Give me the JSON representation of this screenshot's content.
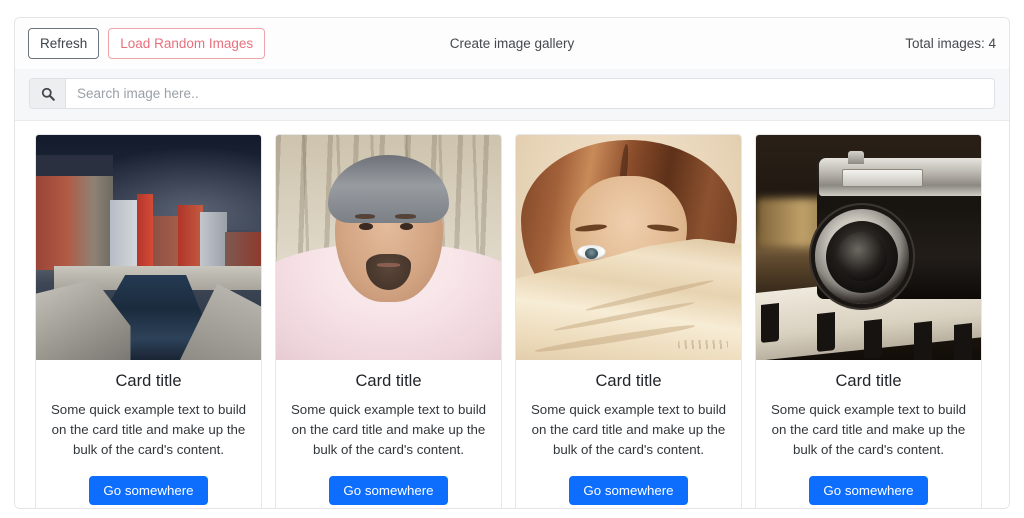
{
  "toolbar": {
    "refresh_label": "Refresh",
    "load_random_label": "Load Random Images",
    "title": "Create image gallery",
    "total_images_label": "Total images: 4"
  },
  "search": {
    "icon": "search-icon",
    "placeholder": "Search image here..",
    "value": ""
  },
  "colors": {
    "primary": "#0d6efd",
    "danger": "#e8707d",
    "secondary": "#6c757d",
    "panel_border": "#e3e5e8",
    "search_bg": "#f6f7f8"
  },
  "cards": [
    {
      "image_name": "riverside-city-photo",
      "image_alt": "Riverside city buildings under a dark blue sky",
      "title": "Card title",
      "text": "Some quick example text to build on the card title and make up the bulk of the card's content.",
      "button_label": "Go somewhere"
    },
    {
      "image_name": "man-portrait-photo",
      "image_alt": "Portrait of a man in a pink shirt outdoors",
      "title": "Card title",
      "text": "Some quick example text to build on the card title and make up the bulk of the card's content.",
      "button_label": "Go somewhere"
    },
    {
      "image_name": "woman-illustration-photo",
      "image_alt": "Illustration of a woman with auburn hair behind a cream cloth",
      "title": "Card title",
      "text": "Some quick example text to build on the card title and make up the bulk of the card's content.",
      "button_label": "Go somewhere"
    },
    {
      "image_name": "vintage-camera-photo",
      "image_alt": "Vintage film camera resting on piano keys",
      "title": "Card title",
      "text": "Some quick example text to build on the card title and make up the bulk of the card's content.",
      "button_label": "Go somewhere"
    }
  ]
}
